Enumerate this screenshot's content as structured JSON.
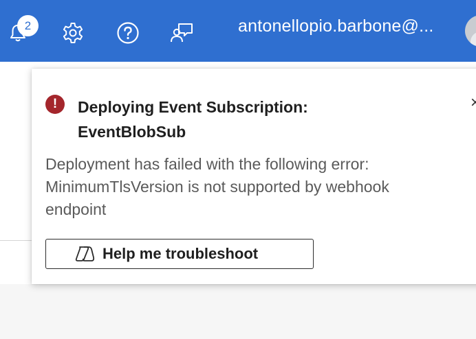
{
  "topbar": {
    "notification_count": "2",
    "icons": {
      "notifications": "bell-icon",
      "settings": "gear-icon",
      "help": "question-icon",
      "feedback": "feedback-icon"
    },
    "user_email": "antonellopio.barbone@..."
  },
  "notification": {
    "title_line1": "Deploying Event Subscription:",
    "title_line2": "EventBlobSub",
    "message_line1": "Deployment has failed with the following error:",
    "message_line2": "MinimumTlsVersion is not supported by webhook",
    "message_line3": "endpoint",
    "close_glyph": "×",
    "button_label": "Help me troubleshoot"
  },
  "colors": {
    "topbar": "#2f6fd0",
    "error": "#a4262c"
  }
}
